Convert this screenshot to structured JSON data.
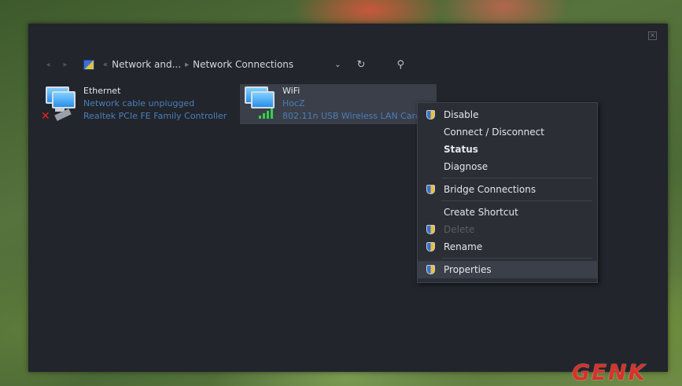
{
  "address_bar": {
    "back": "◂",
    "forward": "▸",
    "overflow": "«",
    "crumb1": "Network and...",
    "sep": "▸",
    "crumb2": "Network Connections",
    "dropdown": "⌄",
    "refresh": "↻",
    "search": "⚲"
  },
  "window": {
    "close": "✕"
  },
  "connections": [
    {
      "name": "Ethernet",
      "status": "Network cable unplugged",
      "device": "Realtek PCIe FE Family Controller"
    },
    {
      "name": "WiFi",
      "status": "HocZ",
      "device": "802.11n USB Wireless LAN Card"
    }
  ],
  "context_menu": {
    "items": [
      {
        "label": "Disable"
      },
      {
        "label": "Connect / Disconnect"
      },
      {
        "label": "Status"
      },
      {
        "label": "Diagnose"
      },
      {
        "label": "Bridge Connections"
      },
      {
        "label": "Create Shortcut"
      },
      {
        "label": "Delete"
      },
      {
        "label": "Rename"
      },
      {
        "label": "Properties"
      }
    ]
  },
  "watermark": {
    "logo": "GENK"
  },
  "colors": {
    "accent": "#4a7fb8",
    "signal": "#35d04a",
    "logo": "#d8322a"
  }
}
